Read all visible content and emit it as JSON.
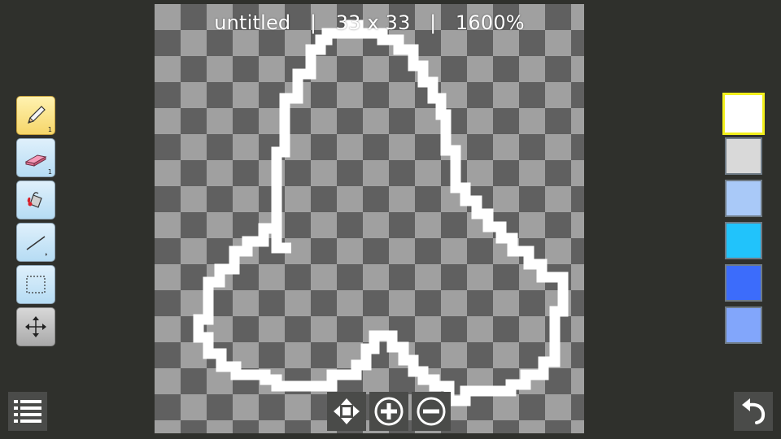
{
  "app": {
    "filename": "untitled",
    "separator": "|",
    "dimensions": "33 x 33",
    "zoom": "1600%"
  },
  "tools": [
    {
      "name": "pencil",
      "icon": "pencil-icon",
      "size": "1",
      "active": true
    },
    {
      "name": "eraser",
      "icon": "eraser-icon",
      "size": "1",
      "active": false
    },
    {
      "name": "fill",
      "icon": "paint-bucket-icon",
      "active": false
    },
    {
      "name": "line",
      "icon": "line-icon",
      "active": false
    },
    {
      "name": "select",
      "icon": "selection-rect-icon",
      "active": false
    },
    {
      "name": "move",
      "icon": "move-icon",
      "active": false
    }
  ],
  "palette": {
    "colors": [
      "#ffffff",
      "#d9d9d9",
      "#a9c9f8",
      "#21c3fb",
      "#3c6cfb",
      "#82a6fb"
    ],
    "selected_index": 0
  },
  "bottom_controls": [
    {
      "name": "pan",
      "icon": "move-arrows-icon"
    },
    {
      "name": "zoom-in",
      "icon": "zoom-in-icon"
    },
    {
      "name": "zoom-out",
      "icon": "zoom-out-icon"
    }
  ],
  "menu": {
    "icon": "menu-list-icon"
  },
  "undo": {
    "icon": "undo-icon"
  },
  "colors": {
    "background": "#2f302c",
    "checker_dark": "#606060",
    "checker_light": "#a0a0a0",
    "stroke": "#ffffff"
  }
}
